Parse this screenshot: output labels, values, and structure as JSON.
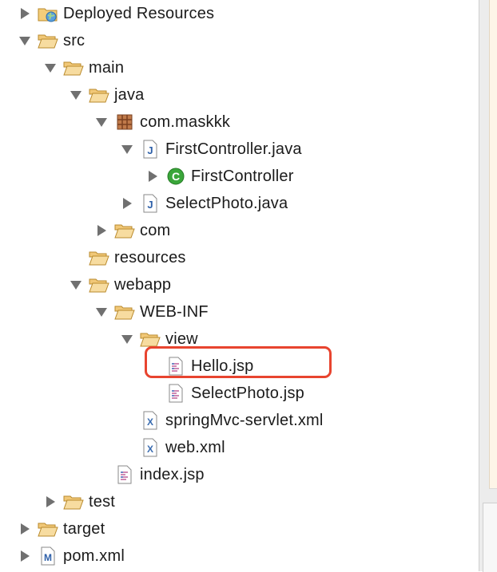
{
  "tree": {
    "deployed_resources": "Deployed Resources",
    "src": "src",
    "main": "main",
    "java": "java",
    "package": "com.maskkk",
    "first_controller_java": "FirstController.java",
    "first_controller_class": "FirstController",
    "select_photo_java": "SelectPhoto.java",
    "com": "com",
    "resources": "resources",
    "webapp": "webapp",
    "web_inf": "WEB-INF",
    "view": "view",
    "hello_jsp": "Hello.jsp",
    "select_photo_jsp": "SelectPhoto.jsp",
    "spring_mvc_servlet": "springMvc-servlet.xml",
    "web_xml": "web.xml",
    "index_jsp": "index.jsp",
    "test": "test",
    "target": "target",
    "pom_xml": "pom.xml"
  },
  "colors": {
    "highlight_border": "#e8442f",
    "folder": "#e9b95c",
    "class_icon": "#3aa63a",
    "java_file": "#2d5fa8",
    "package": "#a4572c"
  },
  "icons": {
    "deployed_resources": "globe-folder-icon",
    "folder": "folder-icon",
    "open_folder": "open-folder-icon",
    "package": "package-icon",
    "java_file": "java-file-icon",
    "class": "class-icon",
    "jsp_file": "jsp-file-icon",
    "xml_file": "xml-file-icon",
    "maven_file": "maven-file-icon"
  }
}
